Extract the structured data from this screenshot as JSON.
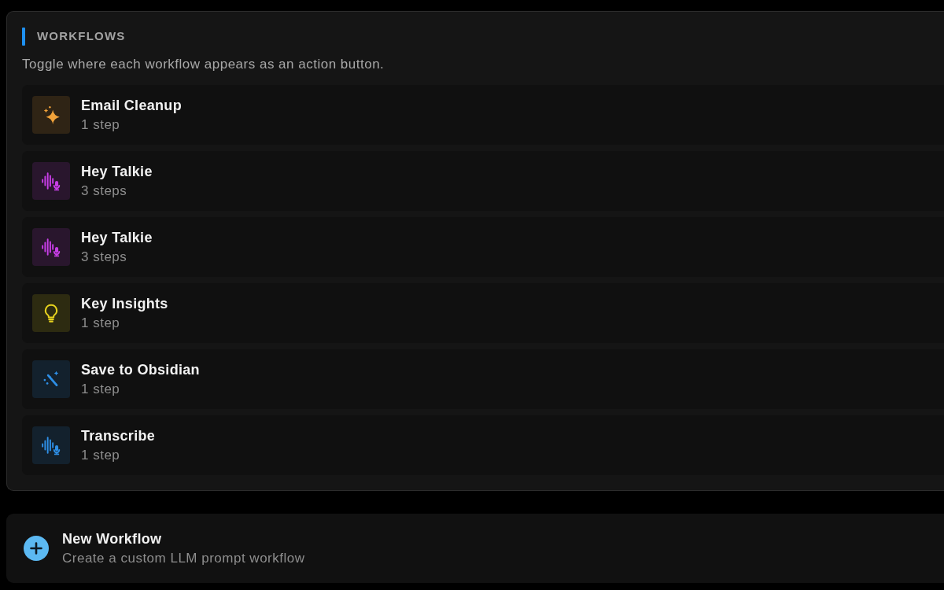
{
  "section": {
    "title": "WORKFLOWS",
    "description": "Toggle where each workflow appears as an action button."
  },
  "workflows": [
    {
      "name": "Email Cleanup",
      "steps": "1 step",
      "kind": "sparkle",
      "color": "#f2a33a"
    },
    {
      "name": "Hey Talkie",
      "steps": "3 steps",
      "kind": "voice",
      "color": "#c73ee6"
    },
    {
      "name": "Hey Talkie",
      "steps": "3 steps",
      "kind": "voice",
      "color": "#c73ee6"
    },
    {
      "name": "Key Insights",
      "steps": "1 step",
      "kind": "bulb",
      "color": "#e6d21e"
    },
    {
      "name": "Save to Obsidian",
      "steps": "1 step",
      "kind": "wand",
      "color": "#2e8fe6"
    },
    {
      "name": "Transcribe",
      "steps": "1 step",
      "kind": "voice",
      "color": "#2e8fe6"
    }
  ],
  "new_workflow": {
    "title": "New Workflow",
    "description": "Create a custom LLM prompt workflow"
  }
}
